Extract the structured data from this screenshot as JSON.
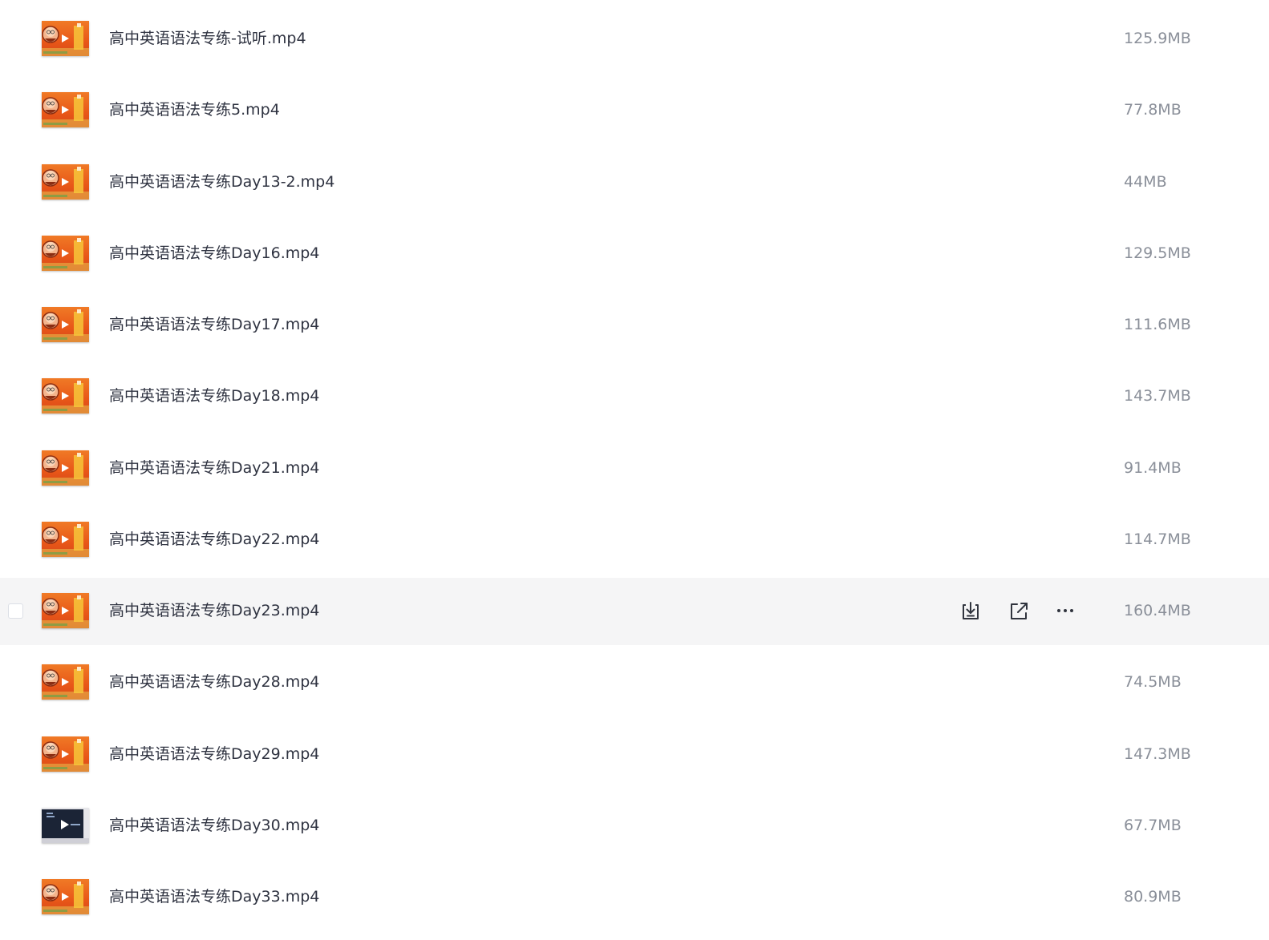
{
  "files": [
    {
      "name": "高中英语语法专练-试听.mp4",
      "size": "125.9MB",
      "thumb": "orange-video-icon"
    },
    {
      "name": "高中英语语法专练5.mp4",
      "size": "77.8MB",
      "thumb": "orange-video-icon"
    },
    {
      "name": "高中英语语法专练Day13-2.mp4",
      "size": "44MB",
      "thumb": "orange-video-icon"
    },
    {
      "name": "高中英语语法专练Day16.mp4",
      "size": "129.5MB",
      "thumb": "orange-video-icon"
    },
    {
      "name": "高中英语语法专练Day17.mp4",
      "size": "111.6MB",
      "thumb": "orange-video-icon"
    },
    {
      "name": "高中英语语法专练Day18.mp4",
      "size": "143.7MB",
      "thumb": "orange-video-icon"
    },
    {
      "name": "高中英语语法专练Day21.mp4",
      "size": "91.4MB",
      "thumb": "orange-video-icon"
    },
    {
      "name": "高中英语语法专练Day22.mp4",
      "size": "114.7MB",
      "thumb": "orange-video-icon"
    },
    {
      "name": "高中英语语法专练Day23.mp4",
      "size": "160.4MB",
      "thumb": "orange-video-icon",
      "hovered": true
    },
    {
      "name": "高中英语语法专练Day28.mp4",
      "size": "74.5MB",
      "thumb": "orange-video-icon"
    },
    {
      "name": "高中英语语法专练Day29.mp4",
      "size": "147.3MB",
      "thumb": "orange-video-icon"
    },
    {
      "name": "高中英语语法专练Day30.mp4",
      "size": "67.7MB",
      "thumb": "dark-video-icon"
    },
    {
      "name": "高中英语语法专练Day33.mp4",
      "size": "80.9MB",
      "thumb": "orange-video-icon"
    }
  ],
  "hover_actions": [
    "download-icon",
    "share-icon",
    "more-icon"
  ],
  "colors": {
    "text": "#2f3341",
    "size_text": "#8a8f99",
    "hover_bg": "#f5f5f6",
    "thumb_orange": "#e8591c",
    "thumb_dark": "#1b2436"
  }
}
